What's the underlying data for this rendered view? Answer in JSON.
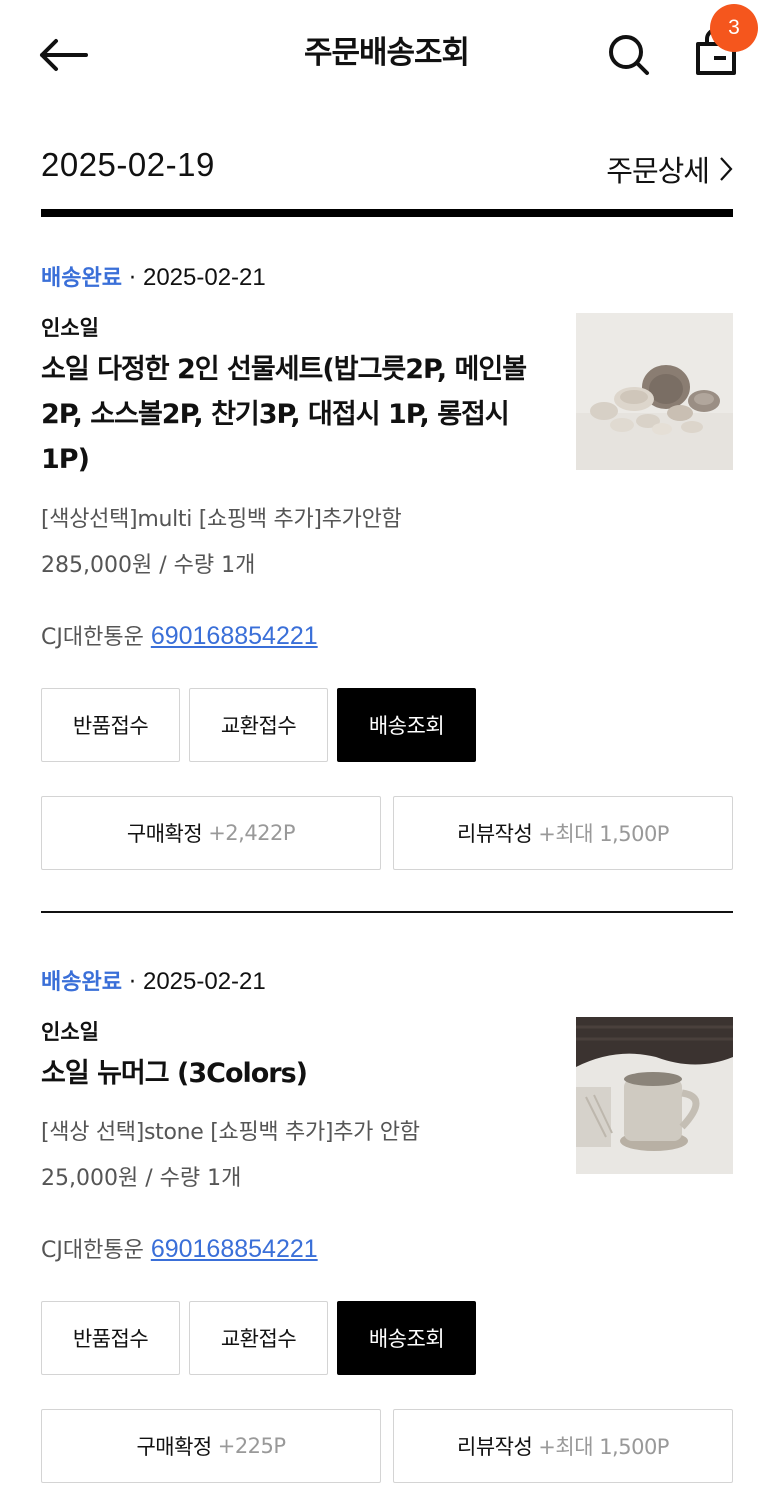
{
  "header": {
    "title": "주문배송조회",
    "cart_count": "3"
  },
  "order": {
    "date": "2025-02-19",
    "detail_link": "주문상세"
  },
  "items": [
    {
      "status": "배송완료",
      "status_sep": "·",
      "status_date": "2025-02-21",
      "brand": "인소일",
      "name": "소일 다정한 2인 선물세트(밥그릇2P, 메인볼2P, 소스볼2P, 찬기3P, 대접시 1P, 롱접시1P)",
      "option": "[색상선택]multi [쇼핑백 추가]추가안함",
      "price": "285,000원 / 수량 1개",
      "courier": "CJ대한통운",
      "tracking": "690168854221",
      "buttons": {
        "return": "반품접수",
        "exchange": "교환접수",
        "track": "배송조회",
        "confirm": "구매확정",
        "confirm_points": "+2,422P",
        "review": "리뷰작성",
        "review_points": "+최대 1,500P"
      }
    },
    {
      "status": "배송완료",
      "status_sep": "·",
      "status_date": "2025-02-21",
      "brand": "인소일",
      "name": "소일 뉴머그 (3Colors)",
      "option": "[색상 선택]stone [쇼핑백 추가]추가 안함",
      "price": "25,000원 / 수량 1개",
      "courier": "CJ대한통운",
      "tracking": "690168854221",
      "buttons": {
        "return": "반품접수",
        "exchange": "교환접수",
        "track": "배송조회",
        "confirm": "구매확정",
        "confirm_points": "+225P",
        "review": "리뷰작성",
        "review_points": "+최대 1,500P"
      }
    }
  ]
}
